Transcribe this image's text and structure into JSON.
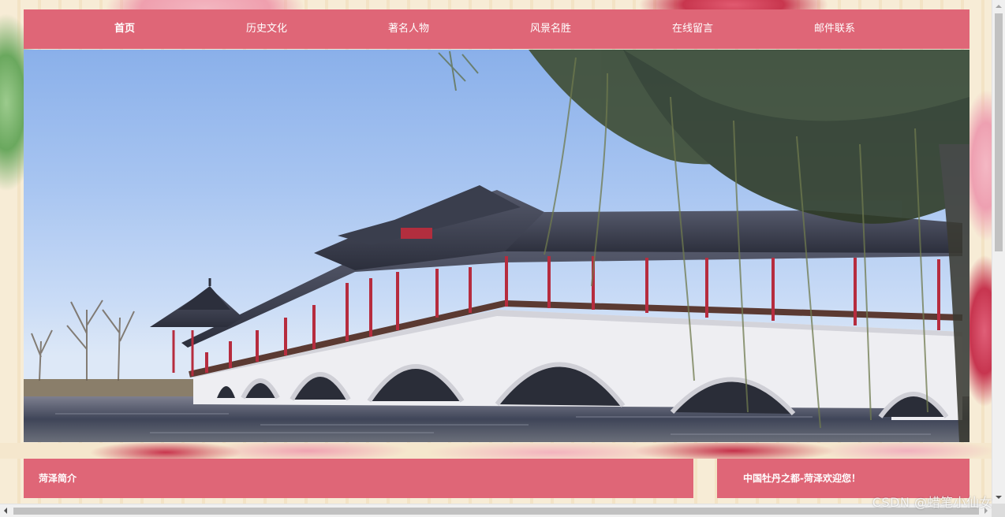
{
  "nav": {
    "items": [
      {
        "label": "首页"
      },
      {
        "label": "历史文化"
      },
      {
        "label": "著名人物"
      },
      {
        "label": "风景名胜"
      },
      {
        "label": "在线留言"
      },
      {
        "label": "邮件联系"
      }
    ]
  },
  "hero": {
    "image_icon": "covered-bridge-landscape-photo"
  },
  "panels": {
    "left_title": "菏泽简介",
    "right_title": "中国牡丹之都-菏泽欢迎您！"
  },
  "watermark": "CSDN @蜡笔小仙女",
  "colors": {
    "accent": "#df6677",
    "nav_text": "#ffffff",
    "background": "#f7ecd6"
  }
}
